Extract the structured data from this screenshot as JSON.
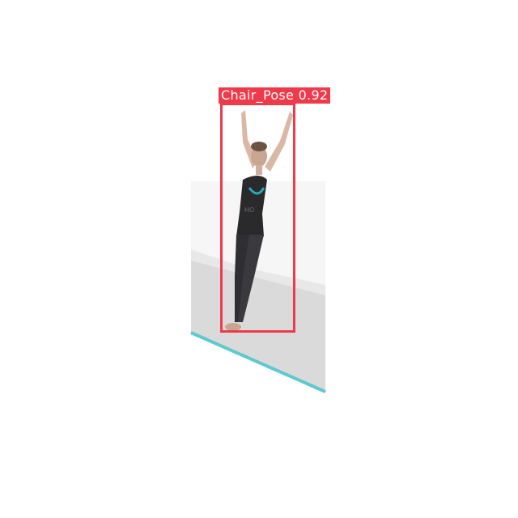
{
  "detection": {
    "class_name": "Chair_Pose",
    "confidence": "0.92",
    "box_color": "#ee3a4a",
    "label_text_color": "#ffffff"
  },
  "scene": {
    "background_color": "#ffffff",
    "floor_color": "#d8d8d8",
    "floor_edge_color": "#5ec9cf",
    "subject": "woman in black sleeveless top and dark leggings standing with arms raised"
  }
}
